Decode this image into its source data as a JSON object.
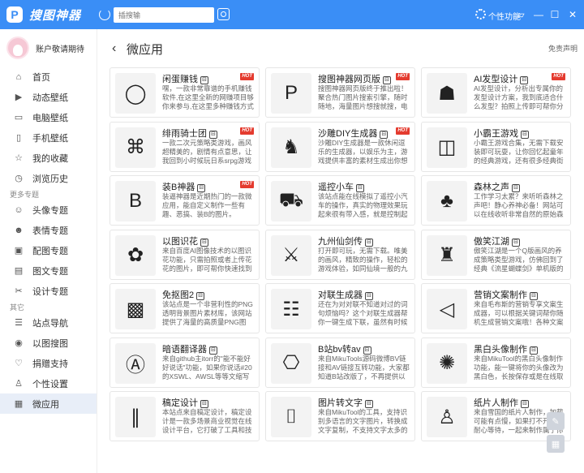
{
  "app": {
    "title": "搜图神器",
    "logo_letter": "P"
  },
  "search": {
    "placeholder": "插搜输"
  },
  "topbar": {
    "personal_label": "个性功能"
  },
  "user": {
    "name": "账户敬请期待"
  },
  "nav": {
    "main": [
      {
        "label": "首页",
        "icon": "home-icon",
        "glyph": "⌂"
      },
      {
        "label": "动态壁纸",
        "icon": "video-icon",
        "glyph": "▶"
      },
      {
        "label": "电脑壁纸",
        "icon": "monitor-icon",
        "glyph": "▭"
      },
      {
        "label": "手机壁纸",
        "icon": "phone-icon",
        "glyph": "▯"
      },
      {
        "label": "我的收藏",
        "icon": "star-icon",
        "glyph": "☆"
      },
      {
        "label": "浏览历史",
        "icon": "clock-icon",
        "glyph": "◷"
      }
    ],
    "more_title": "更多专题",
    "more": [
      {
        "label": "头像专题",
        "icon": "avatar-icon",
        "glyph": "☺"
      },
      {
        "label": "表情专题",
        "icon": "emoji-icon",
        "glyph": "☻"
      },
      {
        "label": "配图专题",
        "icon": "image-icon",
        "glyph": "▣"
      },
      {
        "label": "图文专题",
        "icon": "article-icon",
        "glyph": "▤"
      },
      {
        "label": "设计专题",
        "icon": "design-icon",
        "glyph": "✂"
      }
    ],
    "other_title": "其它",
    "other": [
      {
        "label": "站点导航",
        "icon": "site-icon",
        "glyph": "☰"
      },
      {
        "label": "以图搜图",
        "icon": "camera-icon",
        "glyph": "◉"
      },
      {
        "label": "捐赠支持",
        "icon": "heart-icon",
        "glyph": "♡"
      },
      {
        "label": "个性设置",
        "icon": "user-icon",
        "glyph": "♙"
      },
      {
        "label": "微应用",
        "icon": "apps-icon",
        "glyph": "▦"
      }
    ]
  },
  "page": {
    "title": "微应用",
    "back_glyph": "‹",
    "disclaimer": "免责声明"
  },
  "hot_label": "HOT",
  "tag_glyph": "⊟",
  "cards": [
    {
      "name": "闲蛋赚钱",
      "hot": true,
      "desc": "嘿，一款非常靠谱的手机赚钱软件,在这里全新的网赚项目够你来参与,在这里多种赚钱方式等你来选择,在这里还...",
      "icon": "egg-icon",
      "glyph": "◯"
    },
    {
      "name": "搜图神器网页版",
      "hot": true,
      "desc": "搜图神器网页版终于推出啦！聚合热门图片搜索引擎，随时随地，海量图片想搜就搜，电脑访问体验更佳哦...",
      "icon": "logo-icon",
      "glyph": "P"
    },
    {
      "name": "AI发型设计",
      "hot": true,
      "desc": "AI发型设计，分析出专属你的发型设计方案，我到底适合什么发型？拍照上传即可帮你分析你的面型特点，...",
      "icon": "hair-icon",
      "glyph": "☗"
    },
    {
      "name": "绯雨骑士团",
      "hot": true,
      "desc": "一款二次元策略类游戏，画风超精美的，剧情有点意思，让我回到小时候玩日系srpg游戏《幻想水浒传》的...",
      "icon": "gamepad-icon",
      "glyph": "⌘"
    },
    {
      "name": "沙雕DIY生成器",
      "hot": true,
      "desc": "沙雕DIY生成器是一款休闲逗乐的生成器，以娱乐为主，游戏提供丰富的素材生成出你想要的沙雕作品...",
      "icon": "dancer-icon",
      "glyph": "♞"
    },
    {
      "name": "小霸王游戏",
      "hot": false,
      "desc": "小霸王游戏合集，无需下载安装即可玩耍，让你回忆起童年的经典游戏，还有很多经典街机游戏等你来...",
      "icon": "controller-icon",
      "glyph": "◫"
    },
    {
      "name": "装B神器",
      "hot": true,
      "desc": "装逼神器是近期热门的一款微应用，能自定义制作一些有趣、恶搞、装B的图片。",
      "icon": "letter-b-icon",
      "glyph": "B"
    },
    {
      "name": "遥控小车",
      "hot": false,
      "desc": "该站点能在线模拟了遥控小汽车的操作，真实的物理效果玩起来很有带入感，就是控制起来很考验操作，真...",
      "icon": "car-icon",
      "glyph": "⛟"
    },
    {
      "name": "森林之声",
      "hot": false,
      "desc": "工作学习太累？来听听森林之声吧！静心养神必备！网站可以在线收听非常自然的原始森林声音，实景图片...",
      "icon": "forest-icon",
      "glyph": "♣"
    },
    {
      "name": "以图识花",
      "hot": false,
      "desc": "来自百度AI图像技术的以图识花功能，只需拍照或者上传花花的图片，即可帮你快速找到它是什么花！还有...",
      "icon": "flower-icon",
      "glyph": "✿"
    },
    {
      "name": "九州仙剑传",
      "hot": false,
      "desc": "打开即可玩，无需下载。唯美的画风，精致的操作，轻松的游戏体验，如同仙境一般的九州世界，这就是...",
      "icon": "sword-icon",
      "glyph": "⚔"
    },
    {
      "name": "傲笑江湖",
      "hot": false,
      "desc": "傲笑江湖是一个Q版画风的养成策略类型游戏，仿佛回到了经典《流星蝴蝶剑》单机版的童年时光，小编我也...",
      "icon": "martial-icon",
      "glyph": "♜"
    },
    {
      "name": "免抠图2",
      "hot": false,
      "desc": "该站点是一个非营利性的PNG透明背景图片素材库，该网站提供了海量的高质量PNG图片，专门为设计师提...",
      "icon": "checker-icon",
      "glyph": "▩"
    },
    {
      "name": "对联生成器",
      "hot": false,
      "desc": "还在为对对联不知道对过的词句烦恼吗？这个对联生成器帮你一键生成下联，虽然有时候对的联果很上联...",
      "icon": "couplet-icon",
      "glyph": "☷"
    },
    {
      "name": "营销文案制作",
      "hot": false,
      "desc": "来自毛布斯的营销专享文案生成器，可以根据关键词帮你随机生成营销文案哦！各种文案都有，看看生成的文...",
      "icon": "megaphone-icon",
      "glyph": "◁"
    },
    {
      "name": "暗语翻译器",
      "hot": false,
      "desc": "来自github主itorr的\"能不能好好说话\"功能，如果你说话#20的XSWL、AWSL等等文缩写是啥意思...",
      "icon": "translate-icon",
      "glyph": "Ⓐ"
    },
    {
      "name": "B站bv转av",
      "hot": false,
      "desc": "来自MikuTools源码微博BV链接和AV链接互转功能，大家都知道B站改版了，不再提供以前的AV号，如果...",
      "icon": "bilibili-icon",
      "glyph": "⎔"
    },
    {
      "name": "黑白头像制作",
      "hot": false,
      "desc": "来自MikuTool的黑白头像制作功能，能一键将你的头像改为黑白色，长按保存或是在线取下下载，赶快试试...",
      "icon": "blackwhite-icon",
      "glyph": "✺"
    },
    {
      "name": "稿定设计",
      "hot": false,
      "desc": "本站点来自稿定设计，稿定设计是一款多场景商业视觉在线设计平台，它打破了工具和技术限制，提供海量的...",
      "icon": "design-tools-icon",
      "glyph": "∥"
    },
    {
      "name": "图片转文字",
      "hot": false,
      "desc": "来自MikuTool的工具，支持识别多语言的文字图片，转换成文字复制，不支持文字太多的图片哦！边快试试...",
      "icon": "ocr-icon",
      "glyph": "⌷"
    },
    {
      "name": "纸片人制作",
      "hot": false,
      "desc": "来自雪国的纸片人制作，加载可能有点慢，如果打不开，请耐心等待，一起来制作属于你自己的纸片人吧！...",
      "icon": "paper-doll-icon",
      "glyph": "♙"
    }
  ]
}
